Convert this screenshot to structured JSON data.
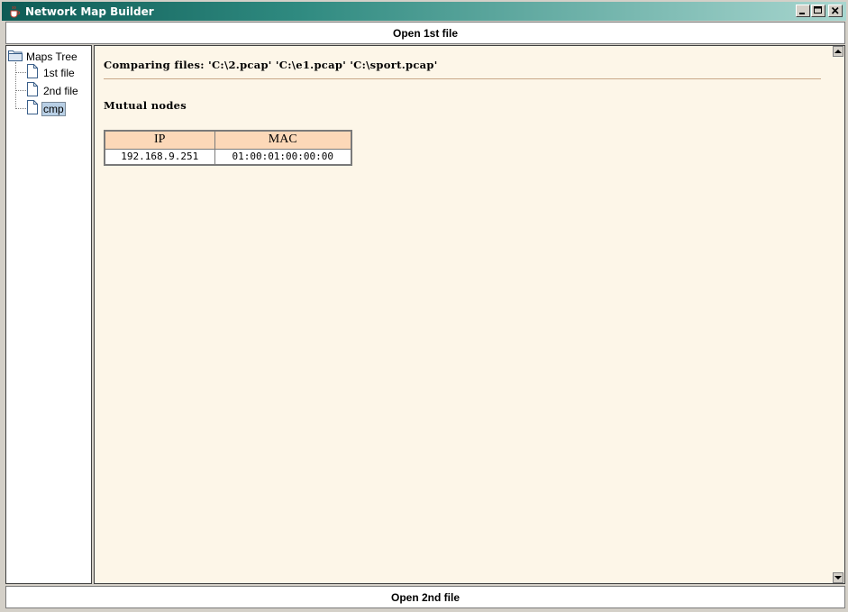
{
  "window": {
    "title": "Network Map Builder",
    "icon": "java-cup-icon",
    "controls": [
      "minimize-icon",
      "maximize-icon",
      "close-icon"
    ]
  },
  "buttons": {
    "open_first": "Open 1st file",
    "open_second": "Open 2nd file"
  },
  "tree": {
    "root_label": "Maps Tree",
    "items": [
      {
        "label": "1st file",
        "icon": "file-icon",
        "selected": false
      },
      {
        "label": "2nd file",
        "icon": "file-icon",
        "selected": false
      },
      {
        "label": "cmp",
        "icon": "file-icon",
        "selected": true
      }
    ]
  },
  "content": {
    "comparing_text": "Comparing files: 'C:\\2.pcap' 'C:\\e1.pcap' 'C:\\sport.pcap'",
    "section_title": "Mutual nodes",
    "table": {
      "headers": [
        "IP",
        "MAC"
      ],
      "rows": [
        [
          "192.168.9.251",
          "01:00:01:00:00:00"
        ]
      ]
    }
  },
  "colors": {
    "title_bar": "#0e5b55",
    "content_bg": "#fdf6e8",
    "table_header_bg": "#fcd8b8",
    "selection_bg": "#b8cfe5"
  }
}
